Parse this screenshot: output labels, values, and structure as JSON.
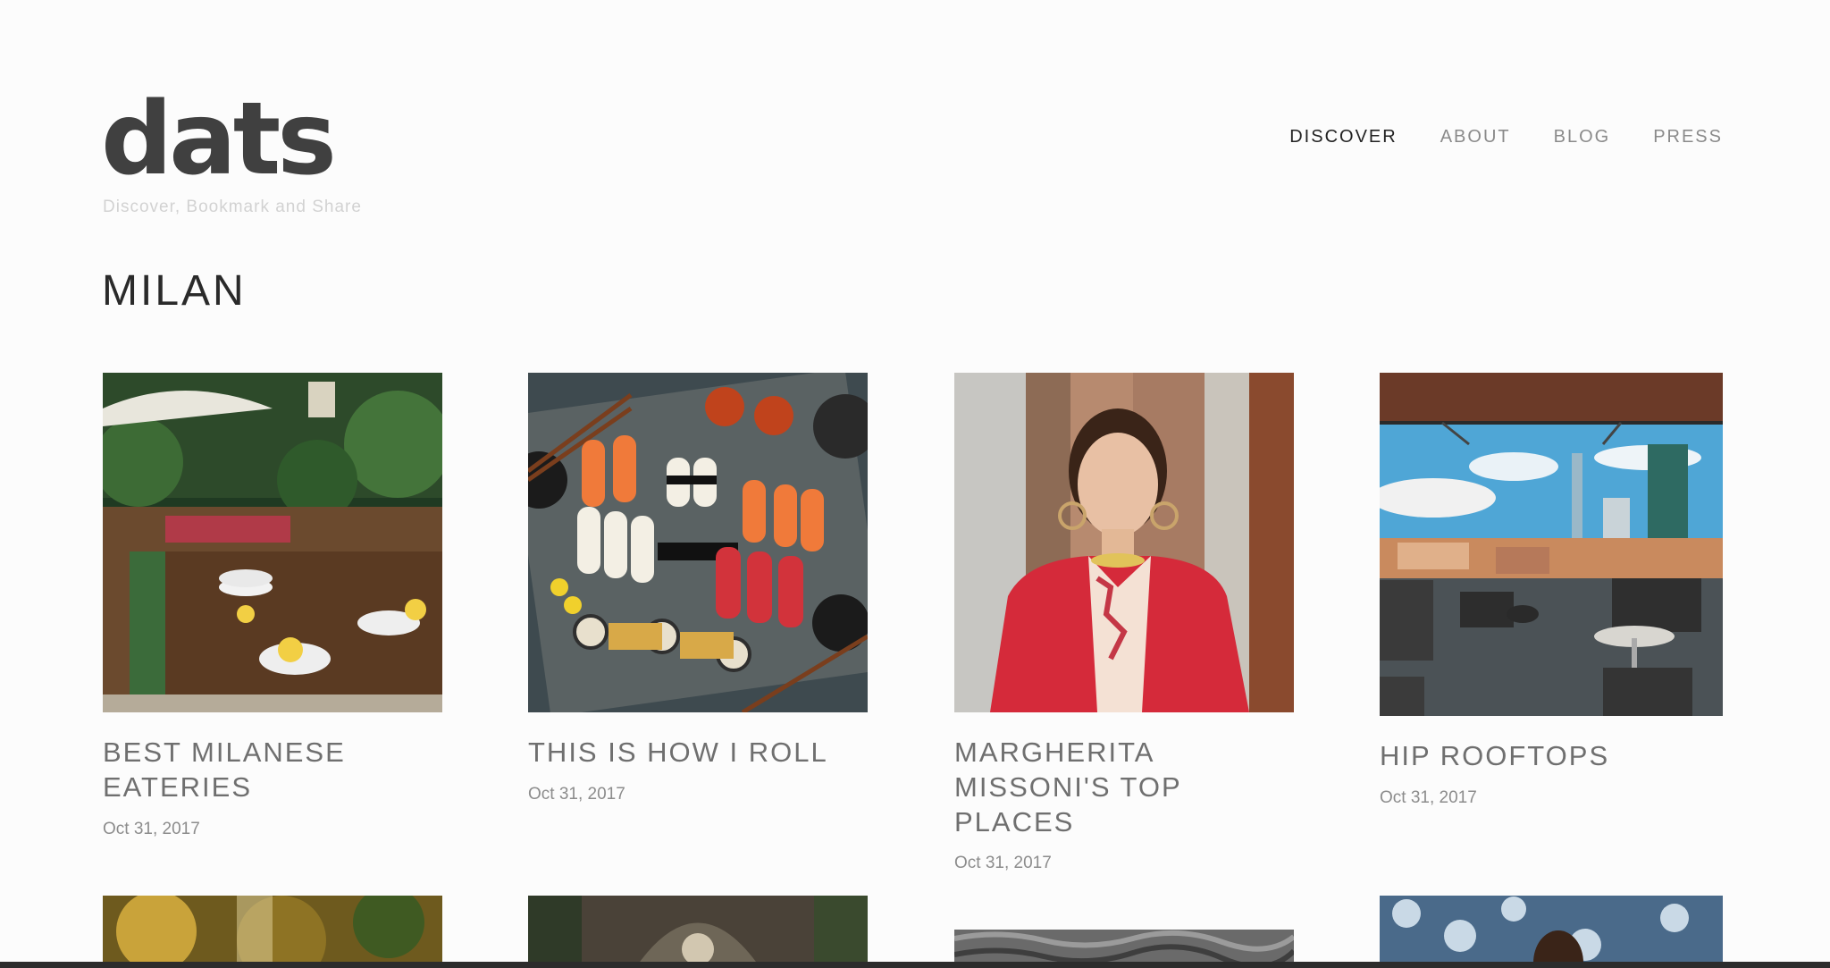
{
  "header": {
    "logo": "dats",
    "tagline": "Discover, Bookmark and Share",
    "nav": [
      "DISCOVER",
      "ABOUT",
      "BLOG",
      "PRESS"
    ]
  },
  "city": "MILAN",
  "cards": [
    {
      "title": "BEST MILANESE EATERIES",
      "date": "Oct 31, 2017"
    },
    {
      "title": "THIS IS HOW I ROLL",
      "date": "Oct 31, 2017"
    },
    {
      "title": "MARGHERITA MISSONI'S TOP PLACES",
      "date": "Oct 31, 2017"
    },
    {
      "title": "HIP ROOFTOPS",
      "date": "Oct 31, 2017"
    }
  ],
  "colors": {
    "background": "#fcfcfc",
    "logo": "#404040",
    "nav_active": "#222222",
    "nav_inactive": "#8a8a8a"
  }
}
